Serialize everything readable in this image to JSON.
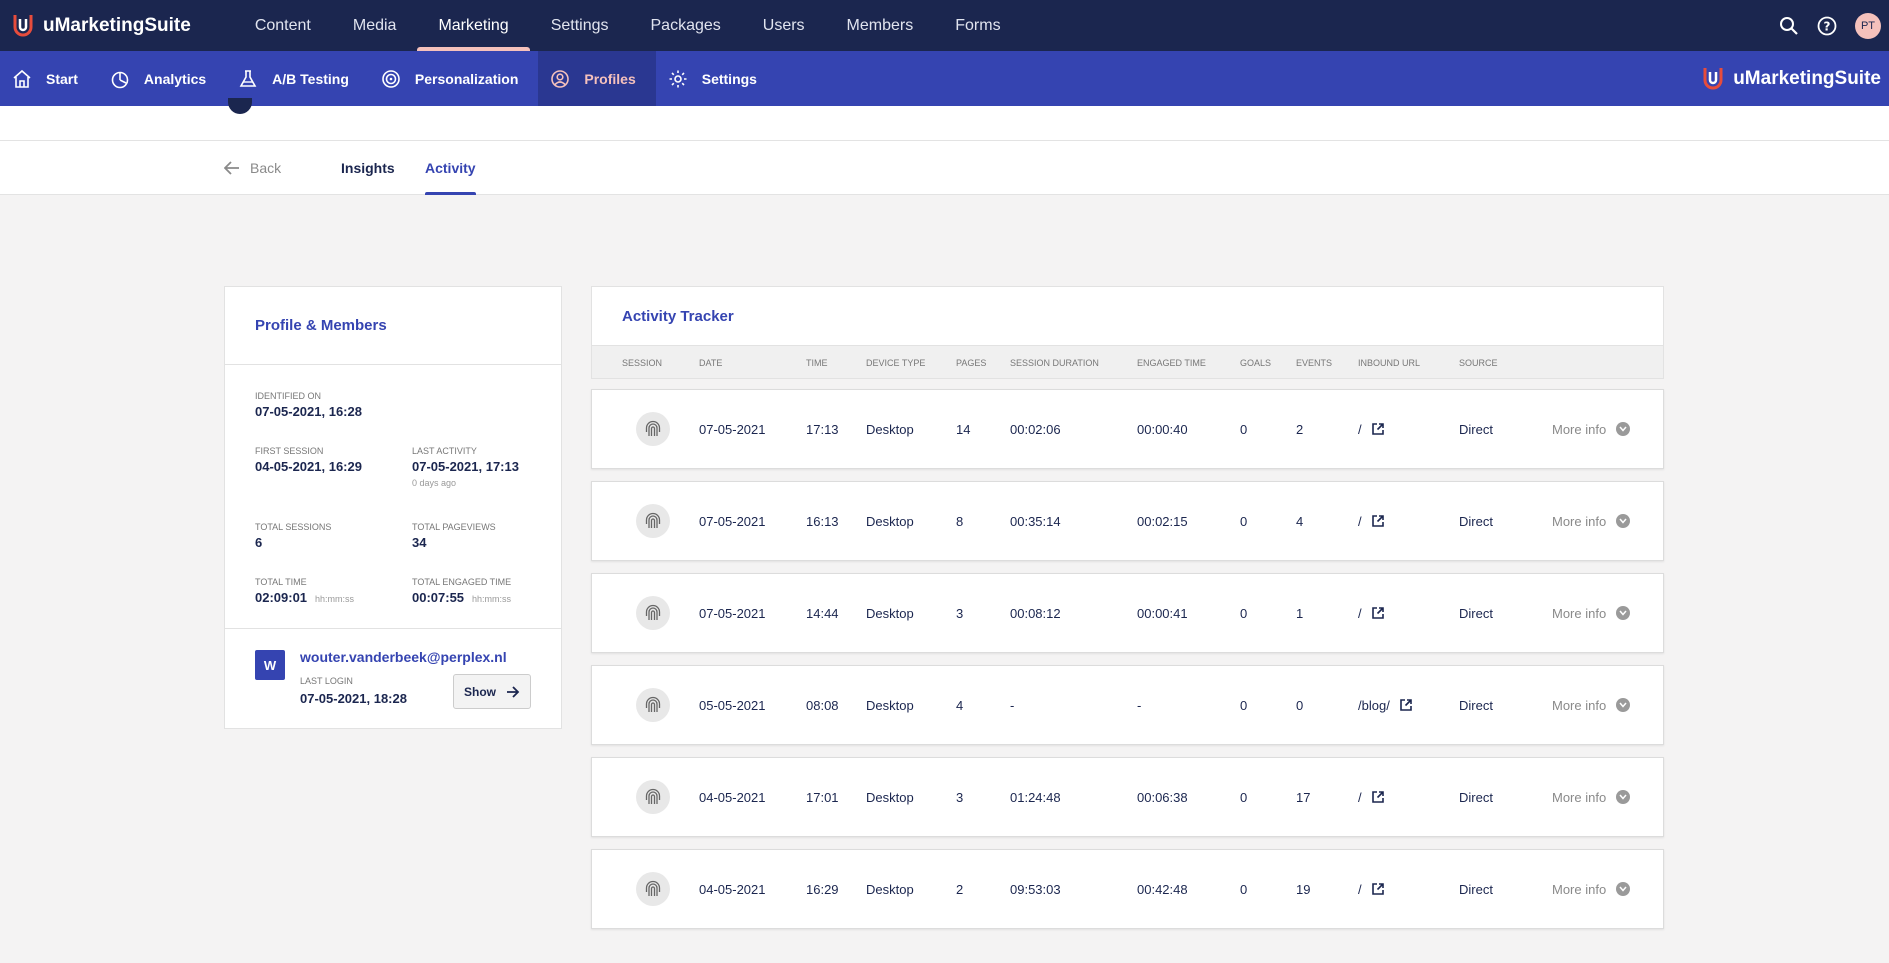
{
  "app": {
    "name": "uMarketingSuite"
  },
  "topnav": {
    "items": [
      "Content",
      "Media",
      "Marketing",
      "Settings",
      "Packages",
      "Users",
      "Members",
      "Forms"
    ],
    "active_index": 2,
    "user_initials": "PT"
  },
  "subnav": {
    "items": [
      "Start",
      "Analytics",
      "A/B Testing",
      "Personalization",
      "Profiles",
      "Settings"
    ],
    "active_index": 4,
    "brand": "uMarketingSuite"
  },
  "tabs": {
    "back": "Back",
    "insights": "Insights",
    "activity": "Activity"
  },
  "profile": {
    "title": "Profile & Members",
    "identified_on_label": "IDENTIFIED ON",
    "identified_on": "07-05-2021, 16:28",
    "first_session_label": "FIRST SESSION",
    "first_session": "04-05-2021, 16:29",
    "last_activity_label": "LAST ACTIVITY",
    "last_activity": "07-05-2021, 17:13",
    "last_activity_ago": "0 days ago",
    "total_sessions_label": "TOTAL SESSIONS",
    "total_sessions": "6",
    "total_pageviews_label": "TOTAL PAGEVIEWS",
    "total_pageviews": "34",
    "total_time_label": "TOTAL TIME",
    "total_time": "02:09:01",
    "total_time_unit": "hh:mm:ss",
    "total_engaged_label": "TOTAL ENGAGED TIME",
    "total_engaged": "00:07:55",
    "total_engaged_unit": "hh:mm:ss",
    "member": {
      "initial": "W",
      "email": "wouter.vanderbeek@perplex.nl",
      "last_login_label": "LAST LOGIN",
      "last_login": "07-05-2021, 18:28",
      "show_label": "Show"
    }
  },
  "tracker": {
    "title": "Activity Tracker",
    "columns": [
      "SESSION",
      "DATE",
      "TIME",
      "DEVICE TYPE",
      "PAGES",
      "SESSION DURATION",
      "ENGAGED TIME",
      "GOALS",
      "EVENTS",
      "INBOUND URL",
      "SOURCE"
    ],
    "more_info_label": "More info",
    "rows": [
      {
        "date": "07-05-2021",
        "time": "17:13",
        "device": "Desktop",
        "pages": "14",
        "duration": "00:02:06",
        "engaged": "00:00:40",
        "goals": "0",
        "events": "2",
        "url": "/",
        "source": "Direct"
      },
      {
        "date": "07-05-2021",
        "time": "16:13",
        "device": "Desktop",
        "pages": "8",
        "duration": "00:35:14",
        "engaged": "00:02:15",
        "goals": "0",
        "events": "4",
        "url": "/",
        "source": "Direct"
      },
      {
        "date": "07-05-2021",
        "time": "14:44",
        "device": "Desktop",
        "pages": "3",
        "duration": "00:08:12",
        "engaged": "00:00:41",
        "goals": "0",
        "events": "1",
        "url": "/",
        "source": "Direct"
      },
      {
        "date": "05-05-2021",
        "time": "08:08",
        "device": "Desktop",
        "pages": "4",
        "duration": "-",
        "engaged": "-",
        "goals": "0",
        "events": "0",
        "url": "/blog/",
        "source": "Direct"
      },
      {
        "date": "04-05-2021",
        "time": "17:01",
        "device": "Desktop",
        "pages": "3",
        "duration": "01:24:48",
        "engaged": "00:06:38",
        "goals": "0",
        "events": "17",
        "url": "/",
        "source": "Direct"
      },
      {
        "date": "04-05-2021",
        "time": "16:29",
        "device": "Desktop",
        "pages": "2",
        "duration": "09:53:03",
        "engaged": "00:42:48",
        "goals": "0",
        "events": "19",
        "url": "/",
        "source": "Direct"
      }
    ]
  },
  "colors": {
    "navy": "#1b264f",
    "blue": "#3544b1",
    "pink": "#f5c1bc",
    "background": "#f4f3f3"
  }
}
